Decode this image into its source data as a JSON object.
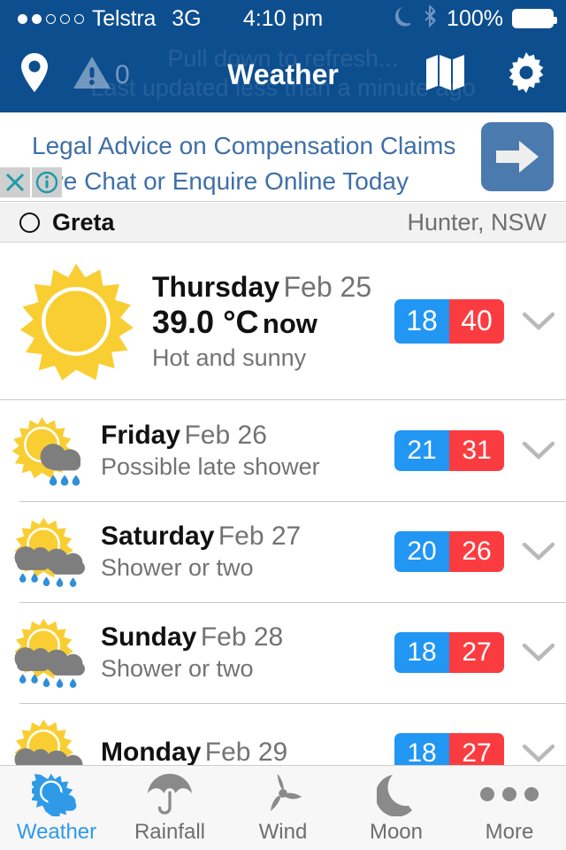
{
  "status_bar": {
    "carrier": "Telstra",
    "network": "3G",
    "time": "4:10 pm",
    "battery_percent": "100%",
    "signal_filled": 2,
    "signal_total": 5,
    "icons": [
      "moon-icon",
      "bluetooth-icon",
      "battery-icon"
    ]
  },
  "nav_bar": {
    "title": "Weather",
    "alert_count": "0",
    "refresh_hint_line1": "Pull down to refresh...",
    "refresh_hint_line2": "Last updated less than a minute ago",
    "left_icons": [
      "location-pin-icon",
      "warning-triangle-icon"
    ],
    "right_icons": [
      "map-icon",
      "gear-icon"
    ],
    "background_color": "#0d4e8f"
  },
  "ad": {
    "line1": "Legal Advice on Compensation Claims",
    "line2": "Live Chat or Enquire Online Today",
    "close_label": "✕",
    "info_label": "i",
    "arrow_label": "➜",
    "text_color": "#3f6fa8",
    "button_color": "#4b7aae"
  },
  "location": {
    "name": "Greta",
    "region": "Hunter, NSW"
  },
  "today": {
    "icon": "sun-icon",
    "day": "Thursday",
    "date": "Feb 25",
    "temperature": "39.0 °C",
    "now_label": "now",
    "description": "Hot and sunny",
    "low": "18",
    "high": "40"
  },
  "forecast": [
    {
      "icon": "sun-cloud-rain-icon",
      "day": "Friday",
      "date": "Feb 26",
      "description": "Possible late shower",
      "low": "21",
      "high": "31"
    },
    {
      "icon": "sun-two-clouds-rain-icon",
      "day": "Saturday",
      "date": "Feb 27",
      "description": "Shower or two",
      "low": "20",
      "high": "26"
    },
    {
      "icon": "sun-two-clouds-rain-icon",
      "day": "Sunday",
      "date": "Feb 28",
      "description": "Shower or two",
      "low": "18",
      "high": "27"
    },
    {
      "icon": "sun-two-clouds-rain-icon",
      "day": "Monday",
      "date": "Feb 29",
      "description": "",
      "low": "18",
      "high": "27"
    }
  ],
  "tabs": [
    {
      "label": "Weather",
      "icon": "sun-cloud-icon",
      "active": true
    },
    {
      "label": "Rainfall",
      "icon": "umbrella-icon",
      "active": false
    },
    {
      "label": "Wind",
      "icon": "windmill-icon",
      "active": false
    },
    {
      "label": "Moon",
      "icon": "moon-icon",
      "active": false
    },
    {
      "label": "More",
      "icon": "ellipsis-icon",
      "active": false
    }
  ],
  "colors": {
    "nav_blue": "#0d4e8f",
    "temp_low": "#2196f3",
    "temp_high": "#fa3c41",
    "sun_yellow": "#f9ce33",
    "cloud_grey": "#7e7e7e",
    "rain_blue": "#2f8fd8",
    "tab_active": "#2f9ae8"
  }
}
